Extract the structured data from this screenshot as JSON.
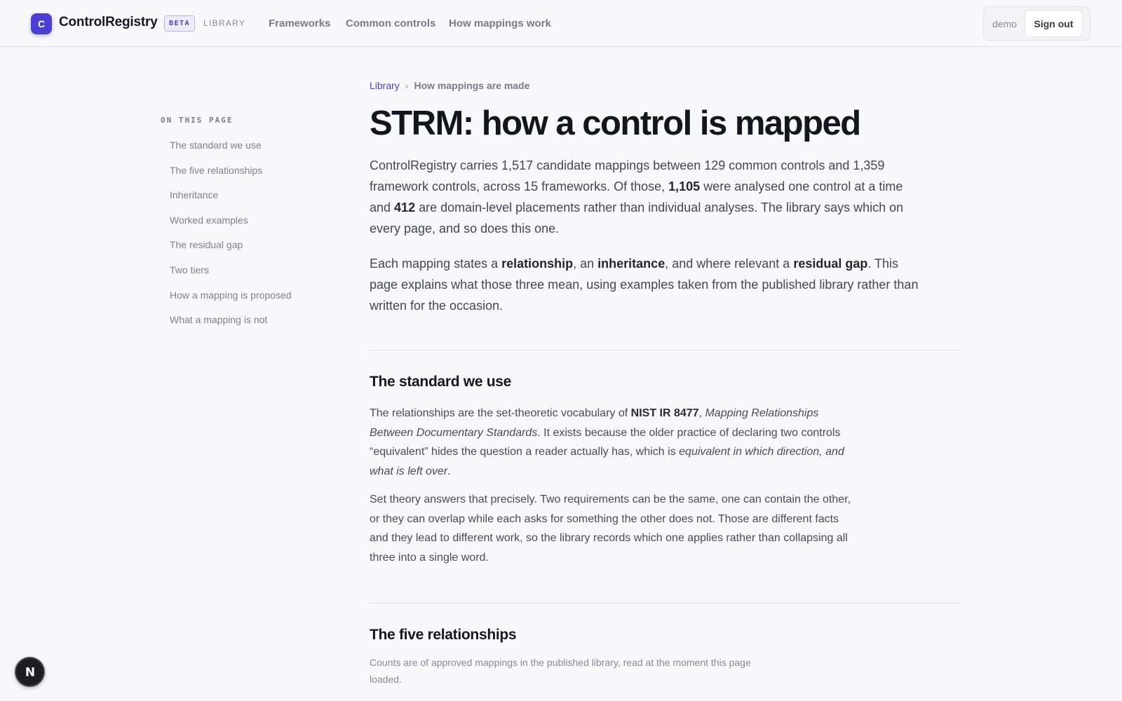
{
  "header": {
    "logo_letter": "C",
    "brand": "ControlRegistry",
    "beta": "BETA",
    "library_tag": "LIBRARY",
    "nav": [
      "Frameworks",
      "Common controls",
      "How mappings work"
    ],
    "user": "demo",
    "sign_out": "Sign out"
  },
  "toc": {
    "title": "ON THIS PAGE",
    "items": [
      "The standard we use",
      "The five relationships",
      "Inheritance",
      "Worked examples",
      "The residual gap",
      "Two tiers",
      "How a mapping is proposed",
      "What a mapping is not"
    ]
  },
  "breadcrumb": {
    "root": "Library",
    "separator": "›",
    "current": "How mappings are made"
  },
  "page_title": "STRM: how a control is mapped",
  "intro": {
    "p1_a": "ControlRegistry carries 1,517 candidate mappings between 129 common controls and 1,359 framework controls, across 15 frameworks. Of those, ",
    "p1_b": "1,105",
    "p1_c": " were analysed one control at a time and ",
    "p1_d": "412",
    "p1_e": " are domain-level placements rather than individual analyses. The library says which on every page, and so does this one.",
    "p2_a": "Each mapping states a ",
    "p2_b": "relationship",
    "p2_c": ", an ",
    "p2_d": "inheritance",
    "p2_e": ", and where relevant a ",
    "p2_f": "residual gap",
    "p2_g": ". This page explains what those three mean, using examples taken from the published library rather than written for the occasion."
  },
  "section1": {
    "title": "The standard we use",
    "p1_a": "The relationships are the set-theoretic vocabulary of ",
    "p1_b": "NIST IR 8477",
    "p1_c": ", ",
    "p1_d": "Mapping Relationships Between Documentary Standards",
    "p1_e": ". It exists because the older practice of declaring two controls “equivalent” hides the question a reader actually has, which is ",
    "p1_f": "equivalent in which direction, and what is left over",
    "p1_g": ".",
    "p2": "Set theory answers that precisely. Two requirements can be the same, one can contain the other, or they can overlap while each asks for something the other does not. Those are different facts and they lead to different work, so the library records which one applies rather than collapsing all three into a single word."
  },
  "section2": {
    "title": "The five relationships",
    "note": "Counts are of approved mappings in the published library, read at the moment this page loaded."
  },
  "badge": {
    "letter": "N"
  },
  "colors": {
    "accent": "#4a3fd1",
    "text": "#1a1a24",
    "muted": "#7a7a86",
    "background": "#f8f8fa"
  }
}
